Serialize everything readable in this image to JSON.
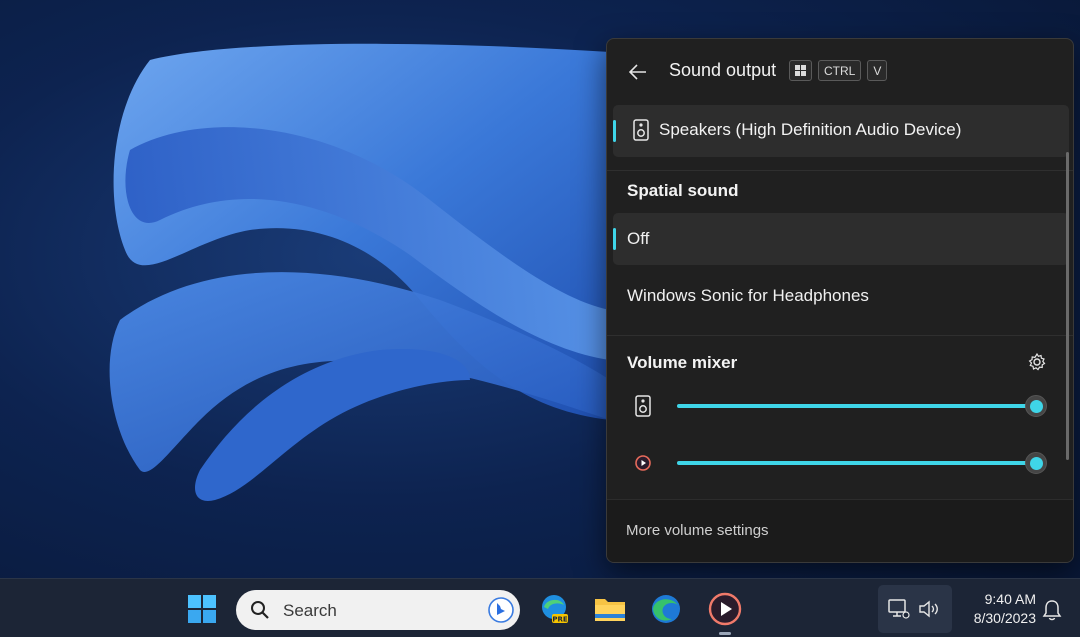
{
  "flyout": {
    "title": "Sound output",
    "shortcut_keys": [
      "CTRL",
      "V"
    ],
    "device": {
      "label": "Speakers (High Definition Audio Device)",
      "icon": "speaker-icon",
      "selected": true
    },
    "spatial_sound": {
      "heading": "Spatial sound",
      "options": [
        {
          "label": "Off",
          "selected": true
        },
        {
          "label": "Windows Sonic for Headphones",
          "selected": false
        }
      ]
    },
    "volume_mixer": {
      "heading": "Volume mixer",
      "sliders": [
        {
          "icon": "speaker-icon",
          "level_percent": 100
        },
        {
          "icon": "media-player-icon",
          "level_percent": 100
        }
      ]
    },
    "footer_link": "More volume settings"
  },
  "taskbar": {
    "search_placeholder": "Search",
    "apps": [
      "windows-start-icon",
      "edge-preview-icon",
      "file-explorer-icon",
      "edge-icon",
      "media-player-icon"
    ],
    "tray": {
      "icons": [
        "network-icon",
        "volume-icon"
      ]
    },
    "time": "9:40 AM",
    "date": "8/30/2023"
  },
  "colors": {
    "accent": "#3fd5e8",
    "flyout_bg": "#202020",
    "taskbar_bg": "#1c2536"
  }
}
